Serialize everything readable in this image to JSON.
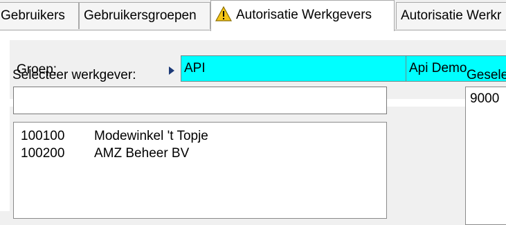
{
  "tabs": [
    {
      "label": "Gebruikers"
    },
    {
      "label": "Gebruikersgroepen"
    },
    {
      "label": "Autorisatie Werkgevers",
      "active": true,
      "icon": "warning-icon"
    },
    {
      "label": "Autorisatie Werkr"
    }
  ],
  "groep": {
    "label": "Groep:",
    "code": "API",
    "name": "Api Demo",
    "field_color": "#00ffff"
  },
  "werkgever": {
    "label": "Selecteer werkgever:",
    "search_value": "",
    "items": [
      {
        "code": "100100",
        "name": "Modewinkel 't Topje"
      },
      {
        "code": "100200",
        "name": "AMZ Beheer BV"
      }
    ]
  },
  "geselecteerd": {
    "label": "Gesele",
    "items": [
      "9000"
    ]
  }
}
